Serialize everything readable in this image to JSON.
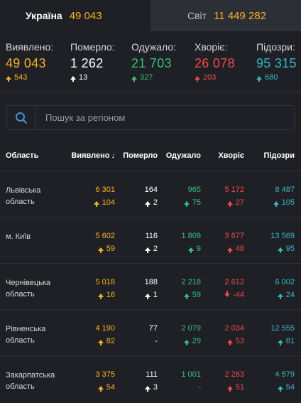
{
  "tabs": [
    {
      "name": "Україна",
      "count": "49 043"
    },
    {
      "name": "Світ",
      "count": "11 449 282"
    }
  ],
  "summary": [
    {
      "label": "Виявлено:",
      "value": "49 043",
      "change": "543",
      "color": "#f5b324",
      "dir": "up"
    },
    {
      "label": "Померло:",
      "value": "1 262",
      "change": "13",
      "color": "#ffffff",
      "dir": "up"
    },
    {
      "label": "Одужало:",
      "value": "21 703",
      "change": "327",
      "color": "#33c27a",
      "dir": "up"
    },
    {
      "label": "Хворіє:",
      "value": "26 078",
      "change": "203",
      "color": "#f1484a",
      "dir": "up"
    },
    {
      "label": "Підозри:",
      "value": "95 315",
      "change": "680",
      "color": "#39b6c4",
      "dir": "up"
    }
  ],
  "search": {
    "placeholder": "Пошук за регіоном"
  },
  "table": {
    "headers": [
      "Область",
      "Виявлено",
      "Померло",
      "Одужало",
      "Хворіє",
      "Підозри"
    ],
    "sort_icon": "arrow-down-icon",
    "rows": [
      {
        "region": "Львівська область",
        "confirmed": "6 301",
        "confirmed_d": "104",
        "deaths": "164",
        "deaths_d": "2",
        "recovered": "965",
        "recovered_d": "75",
        "sick": "5 172",
        "sick_d": "27",
        "suspected": "8 487",
        "suspected_d": "105"
      },
      {
        "region": "м. Київ",
        "confirmed": "5 602",
        "confirmed_d": "59",
        "deaths": "116",
        "deaths_d": "2",
        "recovered": "1 809",
        "recovered_d": "9",
        "sick": "3 677",
        "sick_d": "48",
        "suspected": "13 569",
        "suspected_d": "95"
      },
      {
        "region": "Чернівецька область",
        "confirmed": "5 018",
        "confirmed_d": "16",
        "deaths": "188",
        "deaths_d": "1",
        "recovered": "2 218",
        "recovered_d": "59",
        "sick": "2 612",
        "sick_d": "-44",
        "suspected": "6 002",
        "suspected_d": "24"
      },
      {
        "region": "Рівненська область",
        "confirmed": "4 190",
        "confirmed_d": "82",
        "deaths": "77",
        "deaths_d": "-",
        "recovered": "2 079",
        "recovered_d": "29",
        "sick": "2 034",
        "sick_d": "53",
        "suspected": "12 555",
        "suspected_d": "81"
      },
      {
        "region": "Закарпатська область",
        "confirmed": "3 375",
        "confirmed_d": "54",
        "deaths": "111",
        "deaths_d": "3",
        "recovered": "1 001",
        "recovered_d": "-",
        "sick": "2 263",
        "sick_d": "51",
        "suspected": "4 579",
        "suspected_d": "54"
      }
    ]
  }
}
